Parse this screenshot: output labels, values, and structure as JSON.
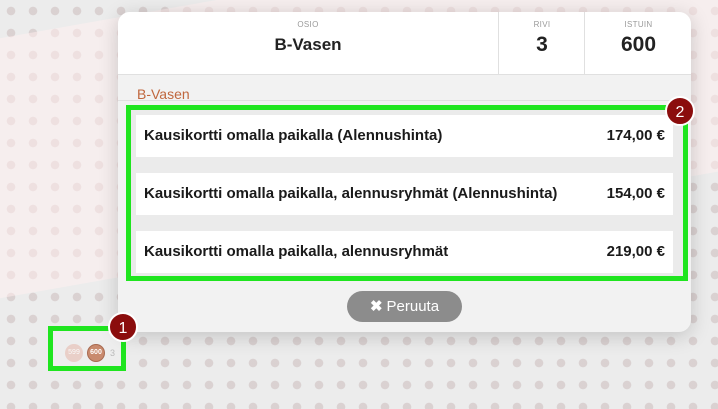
{
  "header": {
    "section_label": "OSIO",
    "section_value": "B-Vasen",
    "row_label": "RIVI",
    "row_value": "3",
    "seat_label": "ISTUIN",
    "seat_value": "600"
  },
  "section_title": "B-Vasen",
  "tickets": [
    {
      "name": "Kausikortti omalla paikalla (Alennushinta)",
      "price": "174,00 €"
    },
    {
      "name": "Kausikortti omalla paikalla, alennusryhmät (Alennushinta)",
      "price": "154,00 €"
    },
    {
      "name": "Kausikortti omalla paikalla, alennusryhmät",
      "price": "219,00 €"
    }
  ],
  "cancel_label": "Peruuta",
  "cancel_icon": "close-icon",
  "seat_marker": {
    "prev_seat": "599",
    "selected_seat": "600",
    "row": "3"
  },
  "annotations": [
    "1",
    "2"
  ],
  "colors": {
    "accent": "#c0673e",
    "highlight": "#1fe51f",
    "badge": "#8b0d0d",
    "cancel_bg": "#8c8c8c"
  }
}
